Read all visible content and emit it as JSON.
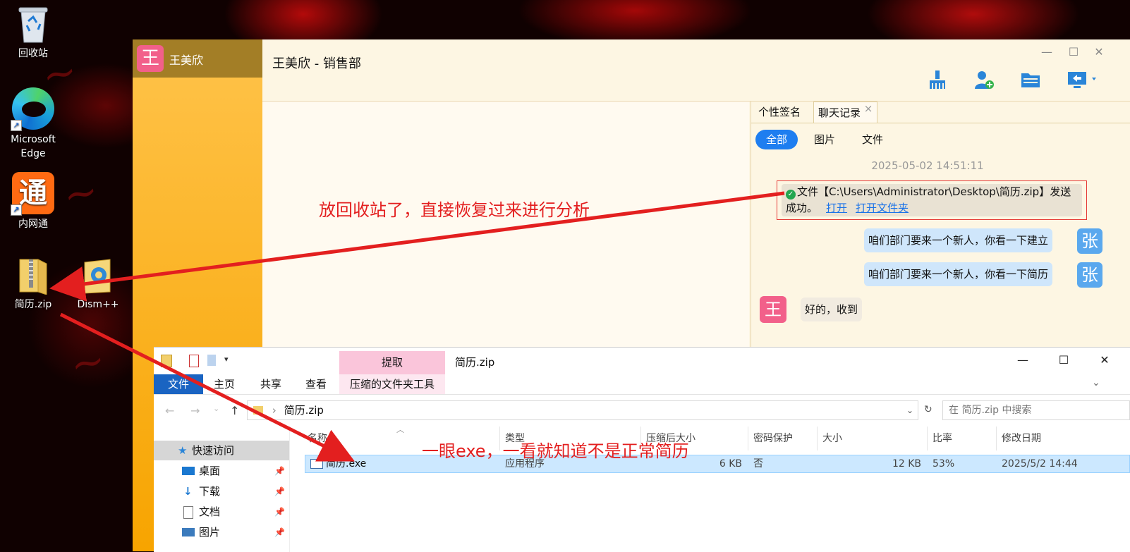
{
  "desktop": {
    "icons": [
      {
        "label": "回收站",
        "icon": "recycle-bin-icon"
      },
      {
        "label": "Microsoft Edge",
        "icon": "edge-icon"
      },
      {
        "label": "内网通",
        "icon": "neiwangtong-icon",
        "glyph": "通"
      },
      {
        "label": "简历.zip",
        "icon": "zip-folder-icon"
      },
      {
        "label": "Dism++",
        "icon": "dism-icon"
      }
    ]
  },
  "chat": {
    "contact": {
      "name": "王美欣",
      "avatar": "王"
    },
    "title": "王美欣 - 销售部",
    "window_controls": {
      "minimize": "—",
      "maximize": "☐",
      "close": "✕"
    },
    "side_tabs": [
      "个性签名",
      "聊天记录"
    ],
    "tab_close": "×",
    "filters": [
      "全部",
      "图片",
      "文件"
    ],
    "timestamp": "2025-05-02 14:51:11",
    "system_message": {
      "text_line1": "文件【C:\\Users\\Administrator\\Desktop\\简历.zip】发送",
      "text_line2": "成功。",
      "link_open": "打开",
      "link_open_folder": "打开文件夹"
    },
    "messages": [
      {
        "side": "right",
        "avatar": "张",
        "text": "咱们部门要来一个新人，你看一下建立"
      },
      {
        "side": "right",
        "avatar": "张",
        "text": "咱们部门要来一个新人，你看一下简历"
      },
      {
        "side": "left",
        "avatar": "王",
        "text": "好的，收到"
      }
    ]
  },
  "explorer": {
    "title": "简历.zip",
    "context_tab": "提取",
    "ribbon_tabs": [
      "文件",
      "主页",
      "共享",
      "查看",
      "压缩的文件夹工具"
    ],
    "address": "简历.zip",
    "search_placeholder": "在 简历.zip 中搜索",
    "nav": [
      {
        "label": "快速访问",
        "icon": "star-icon"
      },
      {
        "label": "桌面",
        "icon": "desktop-icon"
      },
      {
        "label": "下载",
        "icon": "download-icon"
      },
      {
        "label": "文档",
        "icon": "document-icon"
      },
      {
        "label": "图片",
        "icon": "picture-icon"
      }
    ],
    "columns": [
      "名称",
      "类型",
      "压缩后大小",
      "密码保护",
      "大小",
      "比率",
      "修改日期"
    ],
    "rows": [
      {
        "name": "简历.exe",
        "type": "应用程序",
        "compressed": "6 KB",
        "password": "否",
        "size": "12 KB",
        "ratio": "53%",
        "modified": "2025/5/2 14:44"
      }
    ]
  },
  "annotations": {
    "a1": "放回收站了，直接恢复过来进行分析",
    "a2": "一眼exe，一看就知道不是正常简历"
  }
}
